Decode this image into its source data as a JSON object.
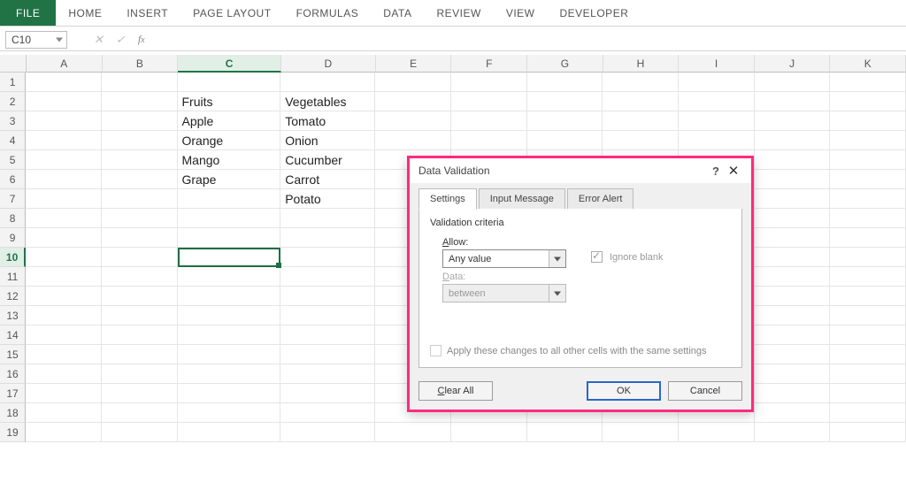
{
  "ribbon": {
    "tabs": [
      "FILE",
      "HOME",
      "INSERT",
      "PAGE LAYOUT",
      "FORMULAS",
      "DATA",
      "REVIEW",
      "VIEW",
      "DEVELOPER"
    ]
  },
  "name_box": {
    "value": "C10"
  },
  "columns": [
    "A",
    "B",
    "C",
    "D",
    "E",
    "F",
    "G",
    "H",
    "I",
    "J",
    "K"
  ],
  "rows": [
    "1",
    "2",
    "3",
    "4",
    "5",
    "6",
    "7",
    "8",
    "9",
    "10",
    "11",
    "12",
    "13",
    "14",
    "15",
    "16",
    "17",
    "18",
    "19"
  ],
  "selected_column": "C",
  "selected_row": "10",
  "cells": {
    "C2": "Fruits",
    "D2": "Vegetables",
    "C3": "Apple",
    "D3": "Tomato",
    "C4": "Orange",
    "D4": "Onion",
    "C5": "Mango",
    "D5": "Cucumber",
    "C6": "Grape",
    "D6": "Carrot",
    "D7": "Potato"
  },
  "dialog": {
    "title": "Data Validation",
    "tabs": {
      "settings": "Settings",
      "input_message": "Input Message",
      "error_alert": "Error Alert"
    },
    "section_title": "Validation criteria",
    "allow_label": "Allow:",
    "allow_value": "Any value",
    "ignore_label": "Ignore blank",
    "data_label": "Data:",
    "data_value": "between",
    "apply_label": "Apply these changes to all other cells with the same settings",
    "clear_btn": "Clear All",
    "ok_btn": "OK",
    "cancel_btn": "Cancel"
  }
}
